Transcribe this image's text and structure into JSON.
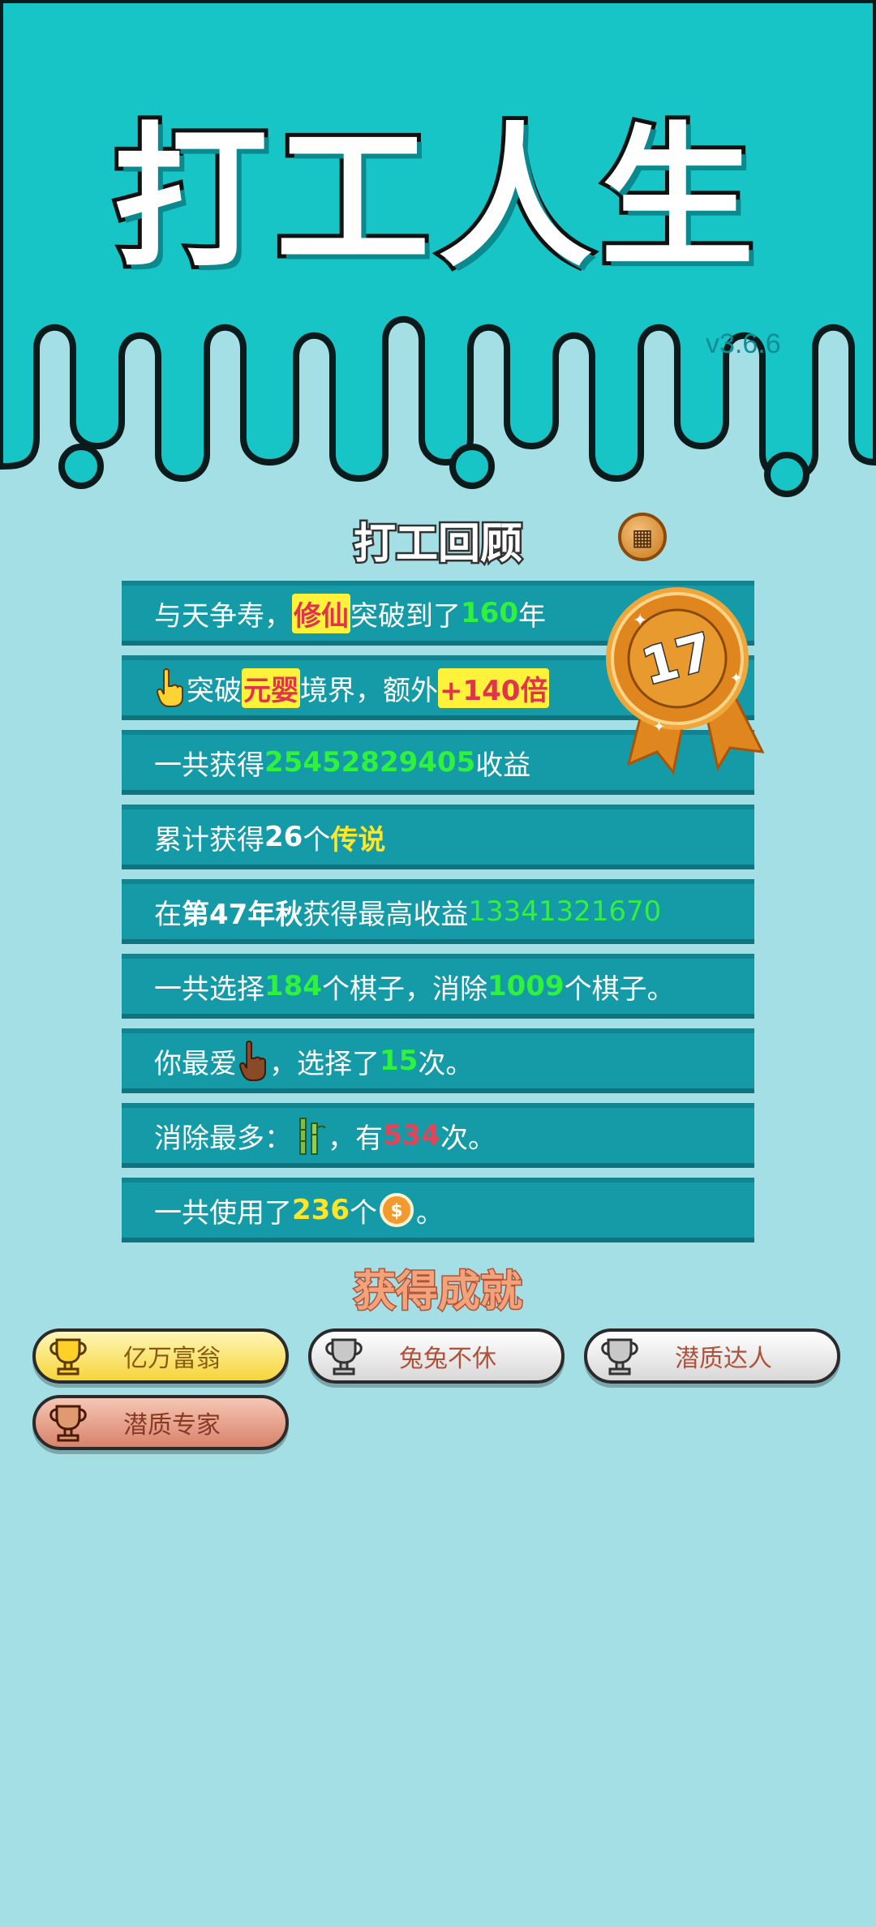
{
  "header": {
    "title": "打工人生",
    "version": "v3.6.6"
  },
  "review": {
    "title": "打工回顾",
    "badge_icon": "settings-tile-icon",
    "medal_level": "17",
    "rows": {
      "r1": {
        "a": "与天争寿，",
        "b": "修仙",
        "c": "突破到了",
        "d": "160",
        "e": "年"
      },
      "r2": {
        "icon": "pointing-hand-icon",
        "a": "突破",
        "b": "元婴",
        "c": "境界，额外",
        "d": "+140倍"
      },
      "r3": {
        "a": "一共获得",
        "b": "25452829405",
        "c": "收益"
      },
      "r4": {
        "a": "累计获得",
        "b": "26",
        "c": "个",
        "d": "传说"
      },
      "r5": {
        "a": "在 ",
        "b": "第47年秋",
        "c": " 获得最高收益",
        "d": "13341321670"
      },
      "r6": {
        "a": "一共选择",
        "b": "184",
        "c": "个棋子，消除",
        "d": "1009",
        "e": "个棋子。"
      },
      "r7": {
        "a": "你最爱",
        "icon": "hand-icon",
        "b": "，选择了",
        "c": "15",
        "d": "次。"
      },
      "r8": {
        "a": "消除最多：",
        "icon": "bamboo-icon",
        "b": "，有",
        "c": "534",
        "d": "次。"
      },
      "r9": {
        "a": "一共使用了",
        "b": "236",
        "c": "个",
        "icon": "coin-icon",
        "d": "。"
      }
    }
  },
  "achievements": {
    "title": "获得成就",
    "items": [
      {
        "label": "亿万富翁",
        "tier": "gold"
      },
      {
        "label": "兔兔不休",
        "tier": "silver"
      },
      {
        "label": "潜质达人",
        "tier": "silver"
      },
      {
        "label": "潜质专家",
        "tier": "bronze"
      }
    ]
  },
  "colors": {
    "top_background": "#17c4c6",
    "page_background": "#a5dfe6",
    "row_background": "#159ba8",
    "highlight_green": "#2ef23c",
    "highlight_yellow": "#ffe628"
  }
}
